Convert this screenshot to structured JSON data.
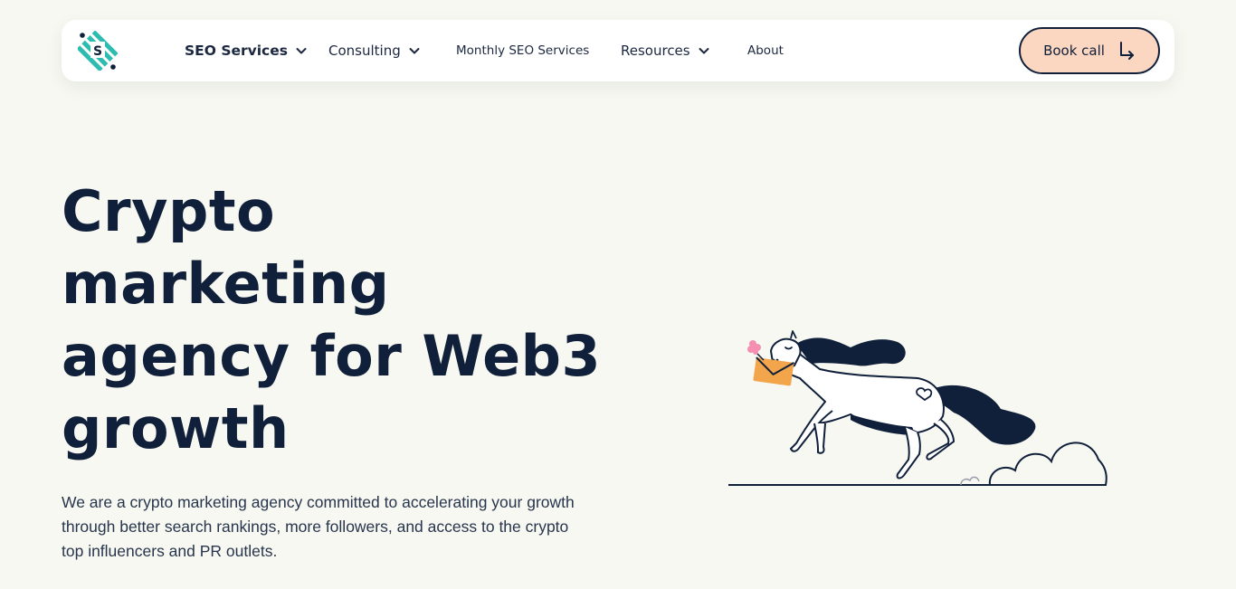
{
  "header": {
    "logo_letter": "S",
    "nav": [
      {
        "label": "SEO Services",
        "has_dropdown": true
      },
      {
        "label": "Consulting",
        "has_dropdown": true
      },
      {
        "label": "Monthly SEO Services",
        "has_dropdown": false
      },
      {
        "label": "Resources",
        "has_dropdown": true
      },
      {
        "label": "About",
        "has_dropdown": false
      }
    ],
    "cta_label": "Book call",
    "cta_icon": "arrow-turn-down-right-icon"
  },
  "hero": {
    "title_lines": [
      "Crypto",
      "marketing",
      "agency for Web3",
      "growth"
    ],
    "subtitle": "We are a crypto marketing agency committed to accelerating your growth through better search rankings, more followers, and access to the crypto top influencers and PR outlets."
  },
  "colors": {
    "background": "#f7f8f1",
    "navy": "#10203a",
    "cta_fill": "#fbd6c1",
    "logo_teal": "#2cbcb0",
    "envelope": "#f2a54a",
    "flower": "#f48fb1"
  }
}
